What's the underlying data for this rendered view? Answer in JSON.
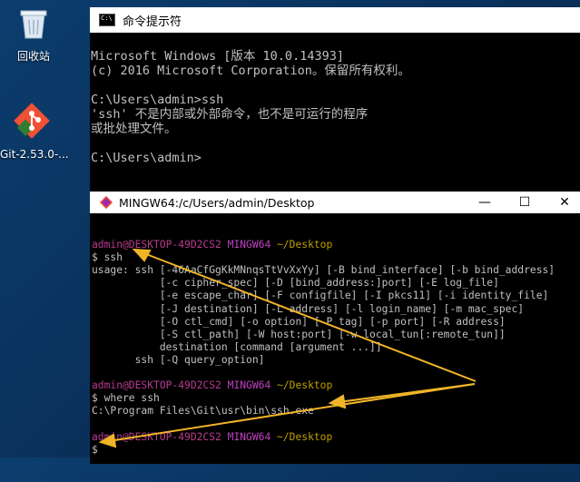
{
  "desktop": {
    "recycle_label": "回收站",
    "git_label": "Git-2.53.0-..."
  },
  "cmd": {
    "title": "命令提示符",
    "lines": [
      "Microsoft Windows [版本 10.0.14393]",
      "(c) 2016 Microsoft Corporation。保留所有权利。",
      "",
      "C:\\Users\\admin>ssh",
      "'ssh' 不是内部或外部命令，也不是可运行的程序",
      "或批处理文件。",
      "",
      "C:\\Users\\admin>"
    ]
  },
  "mingw": {
    "title": "MINGW64:/c/Users/admin/Desktop",
    "prompt_user": "admin@DESKTOP-49D2CS2",
    "prompt_env": "MINGW64",
    "prompt_path": "~/Desktop",
    "cmd1": "$ ssh",
    "usage_lines": [
      "usage: ssh [-46AaCfGgKkMNnqsTtVvXxYy] [-B bind_interface] [-b bind_address]",
      "           [-c cipher_spec] [-D [bind_address:]port] [-E log_file]",
      "           [-e escape_char] [-F configfile] [-I pkcs11] [-i identity_file]",
      "           [-J destination] [-L address] [-l login_name] [-m mac_spec]",
      "           [-O ctl_cmd] [-o option] [-P tag] [-p port] [-R address]",
      "           [-S ctl_path] [-W host:port] [-w local_tun[:remote_tun]]",
      "           destination [command [argument ...]]",
      "       ssh [-Q query_option]"
    ],
    "cmd2": "$ where ssh",
    "where_result": "C:\\Program Files\\Git\\usr\\bin\\ssh.exe",
    "cmd3": "$"
  },
  "colors": {
    "arrow": "#f0b428"
  }
}
